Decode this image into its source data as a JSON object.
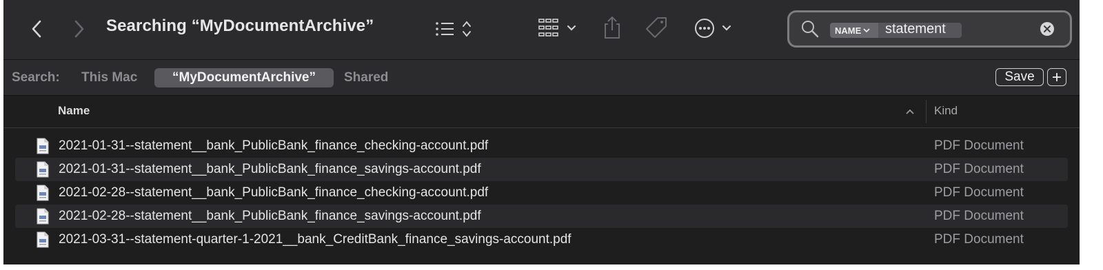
{
  "toolbar": {
    "title": "Searching “MyDocumentArchive”",
    "icons": [
      "back-chevron-icon",
      "forward-chevron-icon",
      "list-view-icon",
      "group-icon",
      "share-icon",
      "tag-icon",
      "more-icon"
    ]
  },
  "search": {
    "token_label": "NAME",
    "value": "statement"
  },
  "scope": {
    "label": "Search:",
    "this_mac": "This Mac",
    "current": "“MyDocumentArchive”",
    "shared": "Shared",
    "save_label": "Save"
  },
  "columns": {
    "name": "Name",
    "kind": "Kind"
  },
  "files": [
    {
      "name": "2021-01-31--statement__bank_PublicBank_finance_checking-account.pdf",
      "kind": "PDF Document"
    },
    {
      "name": "2021-01-31--statement__bank_PublicBank_finance_savings-account.pdf",
      "kind": "PDF Document"
    },
    {
      "name": "2021-02-28--statement__bank_PublicBank_finance_checking-account.pdf",
      "kind": "PDF Document"
    },
    {
      "name": "2021-02-28--statement__bank_PublicBank_finance_savings-account.pdf",
      "kind": "PDF Document"
    },
    {
      "name": "2021-03-31--statement-quarter-1-2021__bank_CreditBank_finance_savings-account.pdf",
      "kind": "PDF Document"
    }
  ],
  "colors": {
    "window_bg": "#1e1e1f",
    "toolbar_bg": "#2b2b2d",
    "row_alt": "#2a2a2c",
    "text": "#e4e4e4",
    "muted": "#9d9da1"
  }
}
